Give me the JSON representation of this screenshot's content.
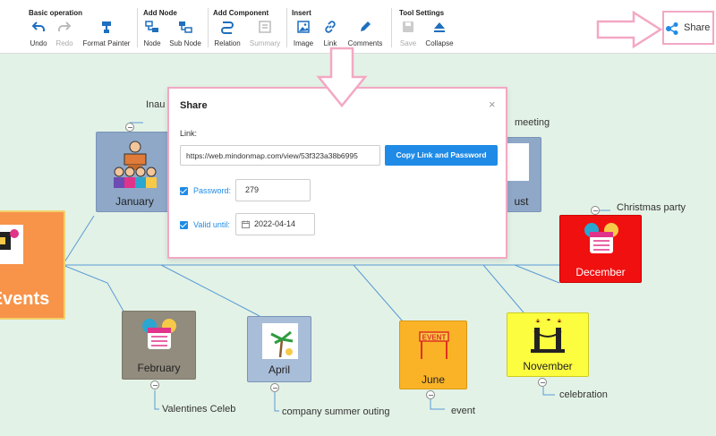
{
  "toolbar": {
    "groups": [
      {
        "title": "Basic operation",
        "tools": [
          {
            "label": "Undo"
          },
          {
            "label": "Redo"
          },
          {
            "label": "Format Painter"
          }
        ]
      },
      {
        "title": "Add Node",
        "tools": [
          {
            "label": "Node"
          },
          {
            "label": "Sub Node"
          }
        ]
      },
      {
        "title": "Add Component",
        "tools": [
          {
            "label": "Relation"
          },
          {
            "label": "Summary"
          }
        ]
      },
      {
        "title": "Insert",
        "tools": [
          {
            "label": "Image"
          },
          {
            "label": "Link"
          },
          {
            "label": "Comments"
          }
        ]
      },
      {
        "title": "Tool Settings",
        "tools": [
          {
            "label": "Save"
          },
          {
            "label": "Collapse"
          }
        ]
      }
    ],
    "share_label": "Share"
  },
  "mindmap": {
    "root_label": "Events",
    "nodes": [
      {
        "label": "January",
        "callout": "Inau"
      },
      {
        "label": "ust",
        "callout": "meeting"
      },
      {
        "label": "December",
        "callout": "Christmas party"
      },
      {
        "label": "February",
        "callout": "Valentines Celeb"
      },
      {
        "label": "April",
        "callout": "company summer outing"
      },
      {
        "label": "June",
        "callout": "event"
      },
      {
        "label": "November",
        "callout": "celebration"
      }
    ],
    "june_banner_text": "EVENT"
  },
  "share_dialog": {
    "title": "Share",
    "close": "×",
    "link_label": "Link:",
    "link_value": "https://web.mindonmap.com/view/53f323a38b6995",
    "copy_button": "Copy Link and Password",
    "password_label": "Password:",
    "password_value": "279",
    "valid_label": "Valid until:",
    "valid_value": "2022-04-14"
  },
  "colors": {
    "accent": "#1f8be6",
    "canvas_bg": "#e3f2e6",
    "annotation": "#f3a8c4",
    "root_node": "#f7944a",
    "december_node": "#f01010",
    "november_node": "#fdfd40",
    "june_node": "#fab327",
    "february_node": "#928c7e",
    "april_node": "#a8bdd8",
    "january_node": "#8fa8c8",
    "august_node": "#8fa8c8"
  }
}
